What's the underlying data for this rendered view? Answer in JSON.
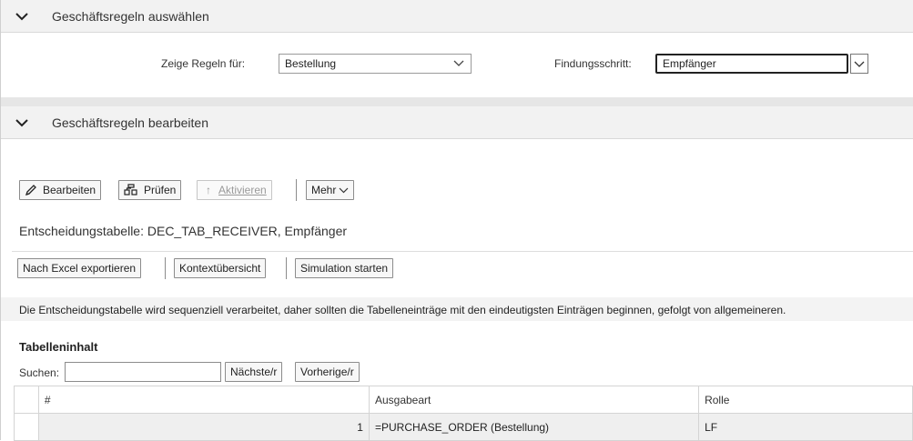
{
  "sections": {
    "select_rules": {
      "title": "Geschäftsregeln auswählen"
    },
    "edit_rules": {
      "title": "Geschäftsregeln bearbeiten"
    }
  },
  "filters": {
    "show_rules_label": "Zeige Regeln für:",
    "show_rules_value": "Bestellung",
    "step_label": "Findungsschritt:",
    "step_value": "Empfänger"
  },
  "toolbar": {
    "edit": "Bearbeiten",
    "check": "Prüfen",
    "activate": "Aktivieren",
    "more": "Mehr"
  },
  "decision_table_title": "Entscheidungstabelle: DEC_TAB_RECEIVER, Empfänger",
  "actions": {
    "export": "Nach Excel exportieren",
    "context": "Kontextübersicht",
    "simulate": "Simulation starten"
  },
  "hint": "Die Entscheidungstabelle wird sequenziell verarbeitet, daher sollten die Tabelleneinträge mit den eindeutigsten Einträgen beginnen, gefolgt von allgemeineren.",
  "table_content": {
    "title": "Tabelleninhalt",
    "search_label": "Suchen:",
    "search_value": "",
    "next": "Nächste/r",
    "prev": "Vorherige/r",
    "columns": [
      "#",
      "Ausgabeart",
      "Rolle"
    ],
    "rows": [
      {
        "num": "1",
        "output_type": "=PURCHASE_ORDER (Bestellung)",
        "role": "LF"
      }
    ]
  }
}
